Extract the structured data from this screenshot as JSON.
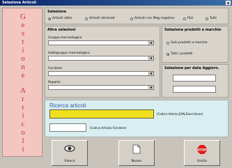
{
  "window": {
    "title": "Selezione Articoli",
    "close_label": "x"
  },
  "sidebar": {
    "word1": [
      "G",
      "e",
      "s",
      "t",
      "i",
      "o",
      "n",
      "e"
    ],
    "word2": [
      "A",
      "r",
      "t",
      "i",
      "c",
      "o",
      "l",
      "i"
    ]
  },
  "selezione": {
    "label": "Selezione",
    "options": [
      {
        "label": "Articoli attivi",
        "selected": true
      },
      {
        "label": "Articoli eliminati",
        "selected": false
      },
      {
        "label": "Articoli con Mag.negativo",
        "selected": false
      },
      {
        "label": "PLU",
        "selected": false
      },
      {
        "label": "Tutti",
        "selected": false
      }
    ]
  },
  "altre": {
    "label": "Altre selezioni",
    "fields": [
      {
        "label": "Gruppo merceologico",
        "value": ""
      },
      {
        "label": "Sottogruppo merceologico",
        "value": ""
      },
      {
        "label": "Fornitore",
        "value": ""
      },
      {
        "label": "Reparto",
        "value": ""
      }
    ]
  },
  "prodotti": {
    "label": "Selezione prodotti a marchio",
    "options": [
      {
        "label": "Solo prodotti a marchio",
        "selected": false
      },
      {
        "label": "Tutti i prodotti",
        "selected": true
      }
    ]
  },
  "data": {
    "label": "Selezione per data Aggiorn.",
    "from": "",
    "to": ""
  },
  "ricerca": {
    "title": "Ricerca articoli",
    "codice_hint": "(Codice Interno,EAN,Descrizione)",
    "fornitore_hint": "(Codice Articolo Fornitore)",
    "codice_value": "",
    "fornitore_value": ""
  },
  "buttons": {
    "elenco": "Elenco",
    "nuovo": "Nuovo",
    "uscita": "Uscita",
    "stop": "STOP"
  },
  "colors": {
    "accent": "#c83028",
    "highlight": "#f0e020"
  }
}
